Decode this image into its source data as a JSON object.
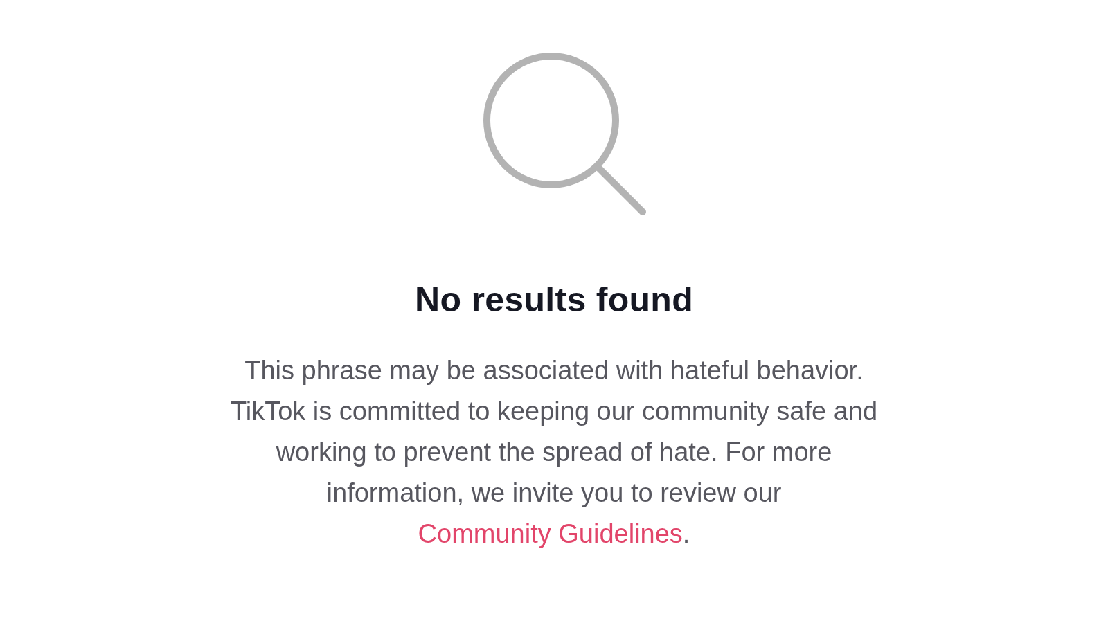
{
  "empty_state": {
    "title": "No results found",
    "message": {
      "text": "This phrase may be associated with hateful behavior. TikTok is committed to keeping our community safe and working to prevent the spread of hate. For more information, we invite you to review our ",
      "link": "Community Guidelines",
      "after": "."
    }
  }
}
